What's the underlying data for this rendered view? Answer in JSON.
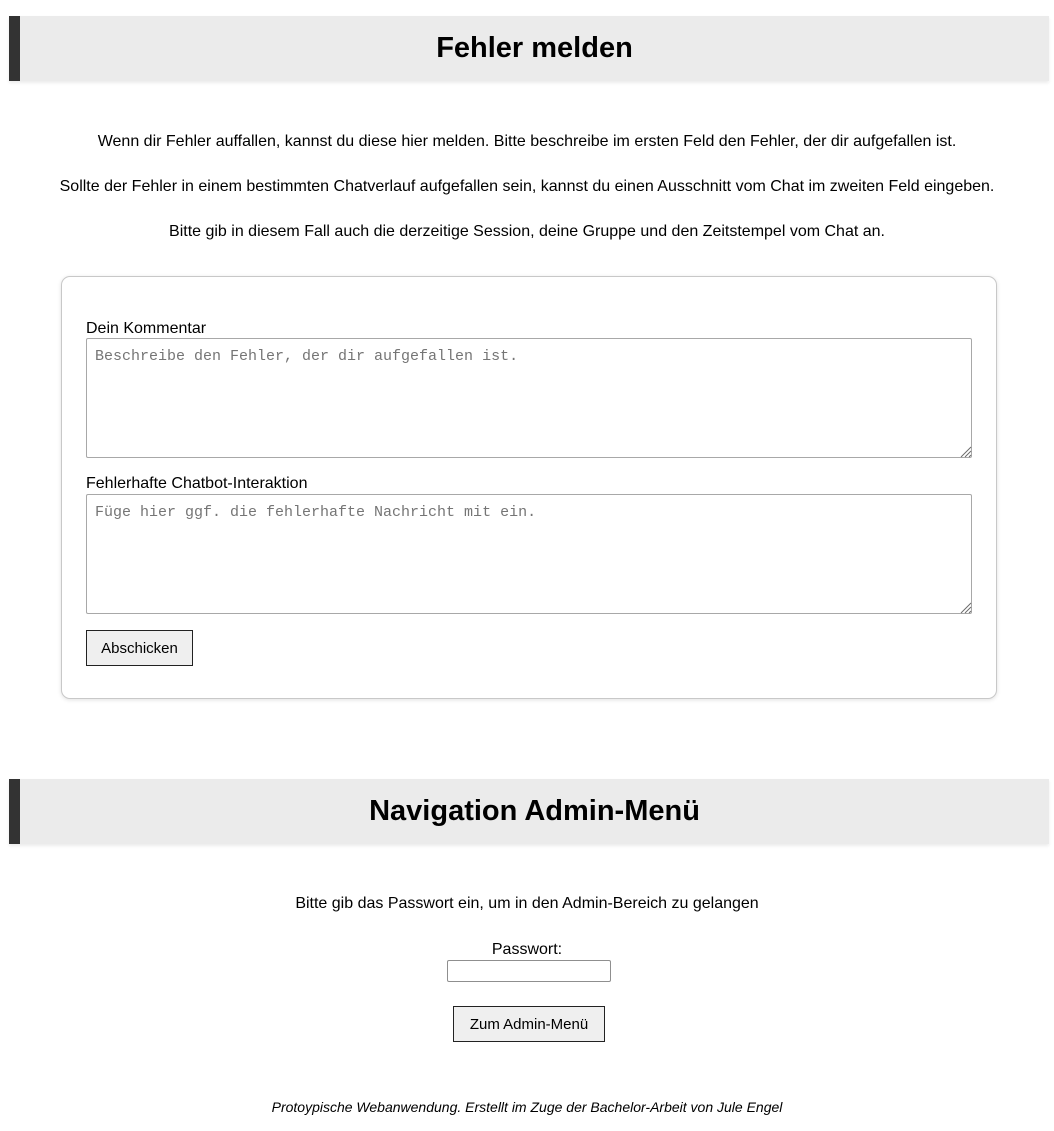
{
  "report_section": {
    "title": "Fehler melden",
    "intro_1": "Wenn dir Fehler auffallen, kannst du diese hier melden. Bitte beschreibe im ersten Feld den Fehler, der dir aufgefallen ist.",
    "intro_2": "Sollte der Fehler in einem bestimmten Chatverlauf aufgefallen sein, kannst du einen Ausschnitt vom Chat im zweiten Feld eingeben.",
    "intro_3": "Bitte gib in diesem Fall auch die derzeitige Session, deine Gruppe und den Zeitstempel vom Chat an.",
    "form": {
      "comment_label": "Dein Kommentar",
      "comment_value": "",
      "comment_placeholder": "Beschreibe den Fehler, der dir aufgefallen ist.",
      "chat_label": "Fehlerhafte Chatbot-Interaktion",
      "chat_value": "",
      "chat_placeholder": "Füge hier ggf. die fehlerhafte Nachricht mit ein.",
      "submit_label": "Abschicken"
    }
  },
  "admin_section": {
    "title": "Navigation Admin-Menü",
    "intro": "Bitte gib das Passwort ein, um in den Admin-Bereich zu gelangen",
    "password_label": "Passwort:",
    "password_value": "",
    "button_label": "Zum Admin-Menü"
  },
  "footer": {
    "text": "Protoypische Webanwendung. Erstellt im Zuge der Bachelor-Arbeit von Jule Engel"
  },
  "colors": {
    "header_background": "#ebebeb",
    "header_accent": "#333333",
    "button_background": "#efefef"
  }
}
